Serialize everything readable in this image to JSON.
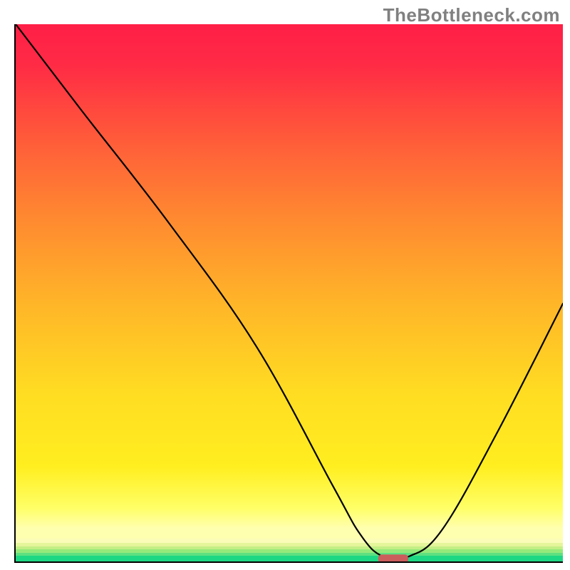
{
  "watermark": "TheBottleneck.com",
  "chart_data": {
    "type": "line",
    "title": "",
    "xlabel": "",
    "ylabel": "",
    "xlim": [
      0,
      100
    ],
    "ylim": [
      0,
      100
    ],
    "series": [
      {
        "name": "bottleneck-curve",
        "x": [
          0,
          12,
          28,
          44,
          58,
          63,
          67,
          72,
          78,
          88,
          100
        ],
        "values": [
          100,
          84,
          63,
          40,
          14,
          5,
          1,
          1,
          6,
          24,
          48
        ]
      }
    ],
    "marker": {
      "x": 69,
      "y": 0.5,
      "width": 5.5,
      "height": 1.6,
      "color": "#cc5d5d"
    },
    "gradient_stops": [
      {
        "pos": 0.0,
        "color": "#ff1f47"
      },
      {
        "pos": 0.08,
        "color": "#ff2b45"
      },
      {
        "pos": 0.22,
        "color": "#ff5a3a"
      },
      {
        "pos": 0.38,
        "color": "#ff8a30"
      },
      {
        "pos": 0.55,
        "color": "#ffb728"
      },
      {
        "pos": 0.72,
        "color": "#ffdd22"
      },
      {
        "pos": 0.86,
        "color": "#ffee20"
      },
      {
        "pos": 0.94,
        "color": "#ffff66"
      },
      {
        "pos": 0.98,
        "color": "#ffffb0"
      }
    ],
    "bottom_bands": [
      {
        "from": 0.957,
        "to": 0.965,
        "color": "#fafcb8"
      },
      {
        "from": 0.965,
        "to": 0.972,
        "color": "#e4f59a"
      },
      {
        "from": 0.972,
        "to": 0.978,
        "color": "#c3ef85"
      },
      {
        "from": 0.978,
        "to": 0.984,
        "color": "#95e97a"
      },
      {
        "from": 0.984,
        "to": 0.99,
        "color": "#5ee081"
      },
      {
        "from": 0.99,
        "to": 1.0,
        "color": "#1ed784"
      }
    ]
  }
}
